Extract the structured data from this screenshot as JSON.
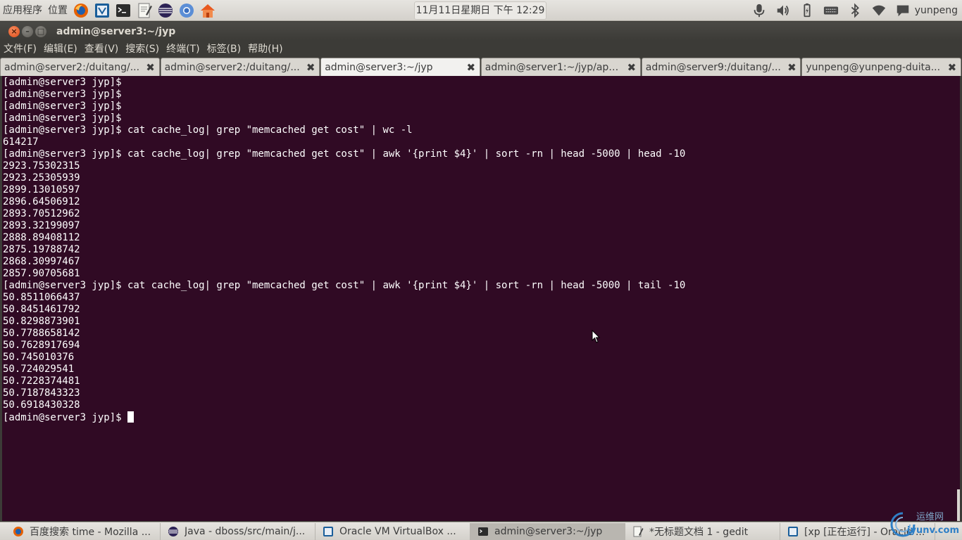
{
  "top_panel": {
    "menu_apps": "应用程序",
    "menu_places": "位置",
    "clock": "11月11日星期日 下午 12:29",
    "user": "yunpeng",
    "launchers": [
      "firefox-icon",
      "virtualbox-icon",
      "terminal-icon",
      "text-editor-icon",
      "eclipse-icon",
      "chromium-icon",
      "home-folder-icon"
    ],
    "indicators": [
      "microphone-icon",
      "volume-icon",
      "battery-icon",
      "keyboard-icon",
      "bluetooth-icon",
      "wifi-icon",
      "chat-icon"
    ]
  },
  "window": {
    "title": "admin@server3:~/jyp"
  },
  "menubar": [
    "文件(F)",
    "编辑(E)",
    "查看(V)",
    "搜索(S)",
    "终端(T)",
    "标签(B)",
    "帮助(H)"
  ],
  "tabs": [
    {
      "label": "admin@server2:/duitang/...",
      "active": false
    },
    {
      "label": "admin@server2:/duitang/...",
      "active": false
    },
    {
      "label": "admin@server3:~/jyp",
      "active": true
    },
    {
      "label": "admin@server1:~/jyp/app/...",
      "active": false
    },
    {
      "label": "admin@server9:/duitang/...",
      "active": false
    },
    {
      "label": "yunpeng@yunpeng-duita...",
      "active": false
    }
  ],
  "tab_close_glyph": "✖",
  "terminal": {
    "lines": [
      "[admin@server3 jyp]$",
      "[admin@server3 jyp]$",
      "[admin@server3 jyp]$",
      "[admin@server3 jyp]$",
      "[admin@server3 jyp]$ cat cache_log| grep \"memcached get cost\" | wc -l",
      "614217",
      "[admin@server3 jyp]$ cat cache_log| grep \"memcached get cost\" | awk '{print $4}' | sort -rn | head -5000 | head -10",
      "2923.75302315",
      "2923.25305939",
      "2899.13010597",
      "2896.64506912",
      "2893.70512962",
      "2893.32199097",
      "2888.89408112",
      "2875.19788742",
      "2868.30997467",
      "2857.90705681",
      "[admin@server3 jyp]$ cat cache_log| grep \"memcached get cost\" | awk '{print $4}' | sort -rn | head -5000 | tail -10",
      "50.8511066437",
      "50.8451461792",
      "50.8298873901",
      "50.7788658142",
      "50.7628917694",
      "50.745010376",
      "50.724029541",
      "50.7228374481",
      "50.7187843323",
      "50.6918430328"
    ],
    "prompt": "[admin@server3 jyp]$ "
  },
  "taskbar": [
    {
      "label": "百度搜索 time - Mozilla ...",
      "icon": "firefox-icon",
      "active": false
    },
    {
      "label": "Java - dboss/src/main/j...",
      "icon": "eclipse-icon",
      "active": false
    },
    {
      "label": "Oracle VM VirtualBox ...",
      "icon": "virtualbox-icon",
      "active": false
    },
    {
      "label": "admin@server3:~/jyp",
      "icon": "terminal-icon",
      "active": true
    },
    {
      "label": "*无标题文档 1 - gedit",
      "icon": "text-editor-icon",
      "active": false
    },
    {
      "label": "[xp [正在运行] - Oracle ...",
      "icon": "virtualbox-icon",
      "active": false
    }
  ],
  "watermark": {
    "top": "运维网",
    "bottom": "iyunv.com"
  },
  "colors": {
    "terminal_bg": "#300a24",
    "terminal_fg": "#ffffff",
    "panel_bg": "#dcd9d3",
    "chrome_dark": "#3c3b37",
    "close_orange": "#df4a16"
  }
}
